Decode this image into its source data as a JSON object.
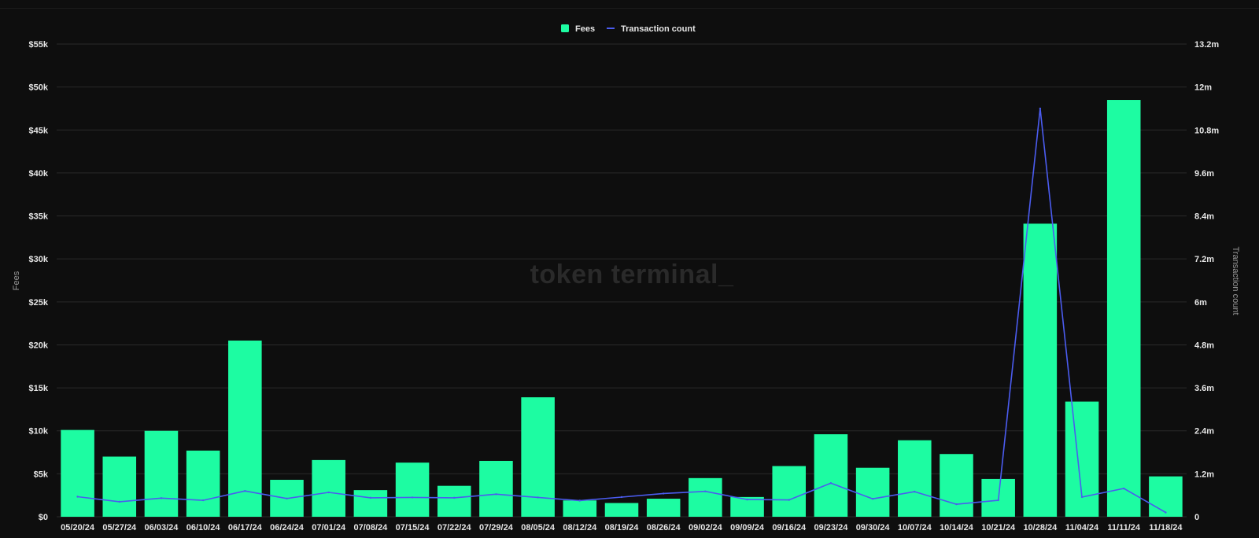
{
  "watermark": "token terminal_",
  "colors": {
    "background": "#0e0e0e",
    "bar": "#1dfca2",
    "line": "#4b5cf0",
    "grid": "#2a2a2a"
  },
  "chart_data": {
    "type": "bar",
    "title": "",
    "xlabel": "",
    "ylabel": "Fees",
    "y2label": "Transaction count",
    "legend": {
      "placement": "top-center",
      "items": [
        {
          "label": "Fees",
          "kind": "bar-swatch"
        },
        {
          "label": "Transaction count",
          "kind": "line-swatch"
        }
      ]
    },
    "grid": true,
    "ylim": [
      0,
      55000
    ],
    "y2lim": [
      0,
      13200000
    ],
    "yticks": [
      "$0",
      "$5k",
      "$10k",
      "$15k",
      "$20k",
      "$25k",
      "$30k",
      "$35k",
      "$40k",
      "$45k",
      "$50k",
      "$55k"
    ],
    "y2ticks": [
      "0",
      "1.2m",
      "2.4m",
      "3.6m",
      "4.8m",
      "6m",
      "7.2m",
      "8.4m",
      "9.6m",
      "10.8m",
      "12m",
      "13.2m"
    ],
    "categories": [
      "05/20/24",
      "05/27/24",
      "06/03/24",
      "06/10/24",
      "06/17/24",
      "06/24/24",
      "07/01/24",
      "07/08/24",
      "07/15/24",
      "07/22/24",
      "07/29/24",
      "08/05/24",
      "08/12/24",
      "08/19/24",
      "08/26/24",
      "09/02/24",
      "09/09/24",
      "09/16/24",
      "09/23/24",
      "09/30/24",
      "10/07/24",
      "10/14/24",
      "10/21/24",
      "10/28/24",
      "11/04/24",
      "11/11/24",
      "11/18/24"
    ],
    "series": [
      {
        "name": "Fees",
        "type": "bar",
        "axis": "left",
        "values": [
          10100,
          7000,
          10000,
          7700,
          20500,
          4300,
          6600,
          3100,
          6300,
          3600,
          6500,
          13900,
          1900,
          1600,
          2100,
          4500,
          2300,
          5900,
          9600,
          5700,
          8900,
          7300,
          4400,
          34100,
          13400,
          48500,
          4700
        ]
      },
      {
        "name": "Transaction count",
        "type": "line",
        "axis": "right",
        "values": [
          560000,
          420000,
          520000,
          460000,
          720000,
          510000,
          680000,
          530000,
          540000,
          530000,
          630000,
          540000,
          450000,
          550000,
          650000,
          710000,
          480000,
          470000,
          940000,
          500000,
          700000,
          350000,
          460000,
          11400000,
          550000,
          790000,
          120000
        ]
      }
    ]
  }
}
